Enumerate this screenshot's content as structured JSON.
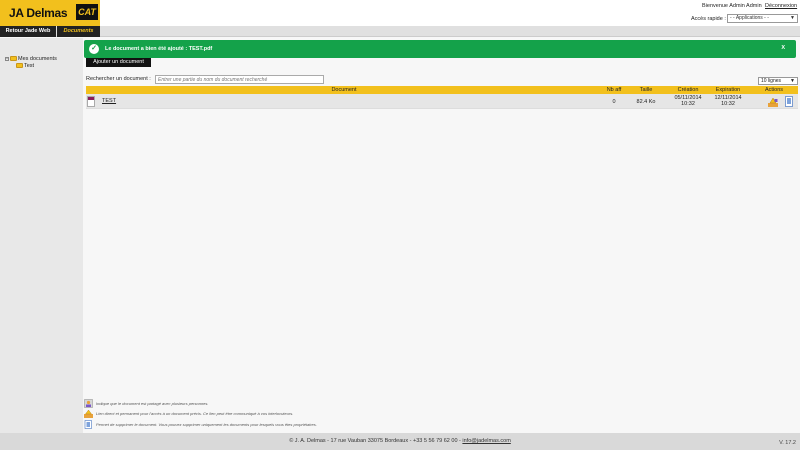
{
  "header": {
    "brand_name": "JA Delmas",
    "brand_logo": "CAT",
    "welcome": "Bienvenue Admin Admin",
    "logout": "Déconnexion",
    "quick_access_label": "Accès rapide :",
    "quick_access_value": "- - Applications - -"
  },
  "nav": {
    "tabs": [
      {
        "label": "Retour Jade Web"
      },
      {
        "label": "Documents"
      }
    ]
  },
  "sidebar": {
    "root_label": "Mes documents",
    "child_label": "Test"
  },
  "main": {
    "success_message": "Le document a bien été ajouté : TEST.pdf",
    "success_close": "X",
    "add_button": "Ajouter un document",
    "search_label": "Rechercher un document :",
    "search_placeholder": "Entrer une partie du nom du document recherché",
    "lines_select": "10 lignes",
    "table": {
      "headers": [
        "Document",
        "Nb aff",
        "Taille",
        "Création",
        "Expiration",
        "Actions"
      ],
      "rows": [
        {
          "document": "TEST",
          "nb_aff": "0",
          "taille": "82.4 Ko",
          "creation_date": "05/11/2014",
          "creation_time": "10:32",
          "expiration_date": "12/11/2014",
          "expiration_time": "10:32"
        }
      ]
    }
  },
  "legend": [
    {
      "icon": "shared-document-icon",
      "text": "Indique que le document est partagé avec plusieurs personnes."
    },
    {
      "icon": "link-icon",
      "text": "Lien direct et permanent pour l'accès à un document précis. Ce lien peut être communiqué à vos interlocuteurs."
    },
    {
      "icon": "delete-icon",
      "text": "Permet de supprimer le document. Vous pouvez supprimer uniquement les documents pour lesquels vous êtes propriétaires."
    }
  ],
  "footer": {
    "text": "© J. A. Delmas - 17 rue Vauban 33075 Bordeaux - +33 5 56 79 62 00 -",
    "email": "info@jadelmas.com",
    "version": "V. 17.2"
  },
  "colors": {
    "brand_yellow": "#f2c01d",
    "success_green": "#14a24a",
    "dark": "#111111"
  }
}
